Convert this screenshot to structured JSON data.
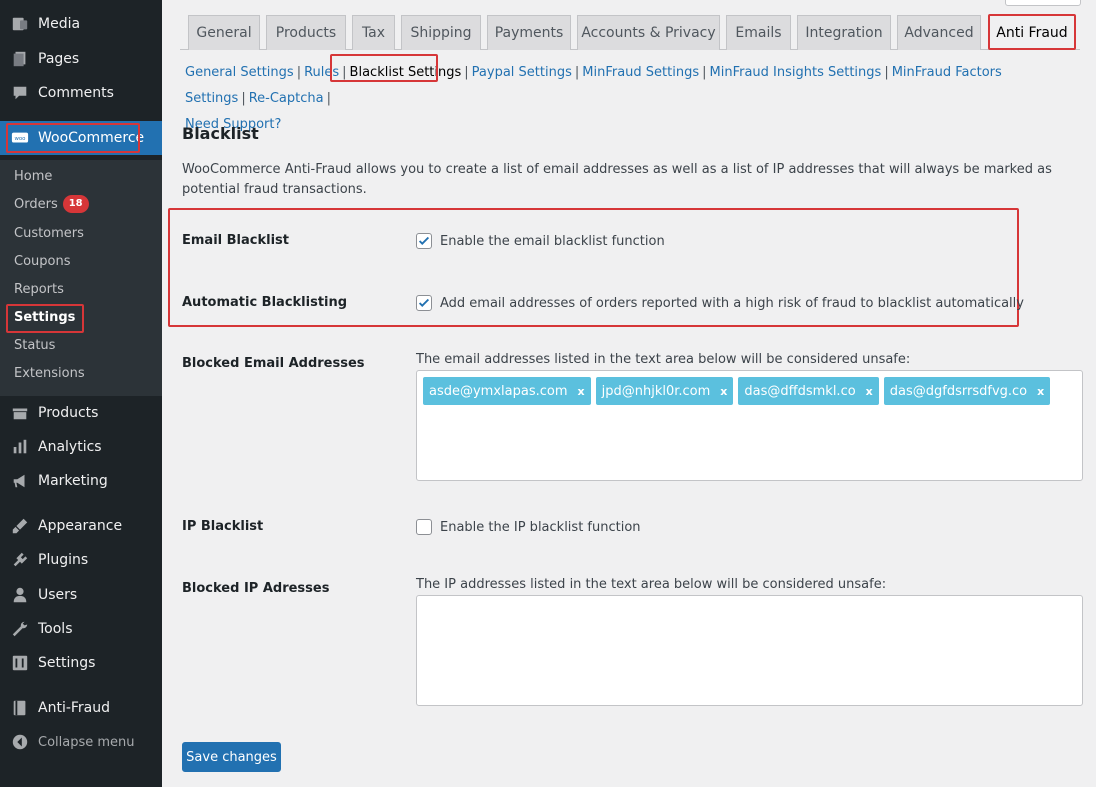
{
  "sidebar": {
    "items": [
      {
        "label": "Media",
        "icon": "media-icon"
      },
      {
        "label": "Pages",
        "icon": "pages-icon"
      },
      {
        "label": "Comments",
        "icon": "comments-icon"
      },
      {
        "label": "WooCommerce",
        "icon": "woocommerce-icon"
      },
      {
        "label": "Products",
        "icon": "products-icon"
      },
      {
        "label": "Analytics",
        "icon": "analytics-icon"
      },
      {
        "label": "Marketing",
        "icon": "marketing-icon"
      },
      {
        "label": "Appearance",
        "icon": "appearance-icon"
      },
      {
        "label": "Plugins",
        "icon": "plugins-icon"
      },
      {
        "label": "Users",
        "icon": "users-icon"
      },
      {
        "label": "Tools",
        "icon": "tools-icon"
      },
      {
        "label": "Settings",
        "icon": "settings-icon"
      },
      {
        "label": "Anti-Fraud",
        "icon": "anti-fraud-icon"
      },
      {
        "label": "Collapse menu",
        "icon": "collapse-icon"
      }
    ],
    "woo_submenu": [
      {
        "label": "Home"
      },
      {
        "label": "Orders",
        "badge": "18"
      },
      {
        "label": "Customers"
      },
      {
        "label": "Coupons"
      },
      {
        "label": "Reports"
      },
      {
        "label": "Settings"
      },
      {
        "label": "Status"
      },
      {
        "label": "Extensions"
      }
    ]
  },
  "tabs": [
    "General",
    "Products",
    "Tax",
    "Shipping",
    "Payments",
    "Accounts & Privacy",
    "Emails",
    "Integration",
    "Advanced",
    "Anti Fraud"
  ],
  "active_tab": "Anti Fraud",
  "subnav": [
    "General Settings",
    "Rules",
    "Blacklist Settings",
    "Paypal Settings",
    "MinFraud Settings",
    "MinFraud Insights Settings",
    "MinFraud Factors Settings",
    "Re-Captcha",
    "Need Support?"
  ],
  "section": {
    "title": "Blacklist",
    "intro": "WooCommerce Anti-Fraud allows you to create a list of email addresses as well as a list of IP addresses that will always be marked as potential fraud transactions."
  },
  "fields": {
    "email_blacklist": {
      "label": "Email Blacklist",
      "text": "Enable the email blacklist function",
      "checked": true
    },
    "auto_blacklisting": {
      "label": "Automatic Blacklisting",
      "text": "Add email addresses of orders reported with a high risk of fraud to blacklist automatically",
      "checked": true
    },
    "blocked_emails": {
      "label": "Blocked Email Addresses",
      "desc": "The email addresses listed in the text area below will be considered unsafe:",
      "chips": [
        "asde@ymxlapas.com",
        "jpd@nhjkl0r.com",
        "das@dffdsmkl.co",
        "das@dgfdsrrsdfvg.co"
      ],
      "remove": "x"
    },
    "ip_blacklist": {
      "label": "IP Blacklist",
      "text": "Enable the IP blacklist function",
      "checked": false
    },
    "blocked_ips": {
      "label": "Blocked IP Adresses",
      "desc": "The IP addresses listed in the text area below will be considered unsafe:"
    }
  },
  "save_label": "Save changes",
  "colors": {
    "accent": "#2271b1",
    "highlight": "#d63638",
    "chip": "#5bc0de"
  }
}
